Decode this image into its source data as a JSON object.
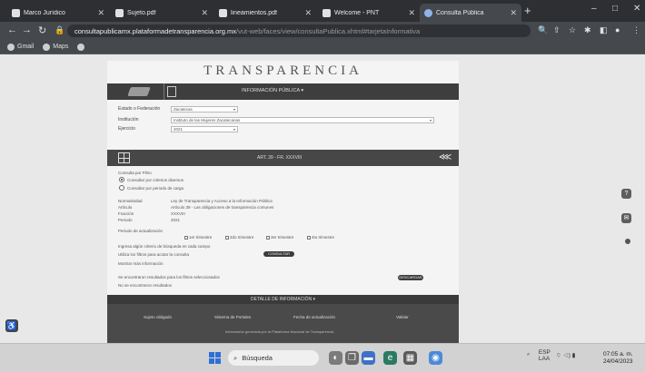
{
  "browser": {
    "tabs": [
      {
        "label": "Marco Jurídico",
        "active": false
      },
      {
        "label": "Sujeto.pdf",
        "active": false
      },
      {
        "label": "lineamientos.pdf",
        "active": false
      },
      {
        "label": "Welcome - PNT",
        "active": false
      },
      {
        "label": "Consulta Pública",
        "active": true
      }
    ],
    "new_tab": "+",
    "window_controls": [
      "–",
      "□",
      "✕"
    ],
    "url_host": "consultapublicamx.plataformadetransparencia.org.mx",
    "url_path": "/vut-web/faces/view/consultaPublica.xhtml#tarjetaInformativa",
    "bookmarks": [
      "Gmail",
      "Maps"
    ]
  },
  "site": {
    "brand": "TRANSPARENCIA",
    "nav_label": "INFORMACIÓN PÚBLICA",
    "form": {
      "state_label": "Estado o Federación",
      "state_value": "Zacatecas",
      "institution_label": "Institución",
      "institution_value": "Instituto de las Mujeres Zacatecanas",
      "period_label": "Ejercicio",
      "period_value": "2021"
    },
    "section_label": "ART. 39 - FR. XXXVIII",
    "filter_title": "Consulta por Filtro",
    "filter_options": [
      "Consultar por criterios diversos",
      "Consultar por periodo de carga"
    ],
    "info_rows": [
      {
        "k": "Normatividad",
        "v": "Ley de Transparencia y Acceso a la Información Pública"
      },
      {
        "k": "Artículo",
        "v": "Artículo 39 - Las obligaciones de transparencia comunes"
      },
      {
        "k": "Fracción",
        "v": "XXXVIII"
      },
      {
        "k": "Periodo",
        "v": "2021"
      }
    ],
    "period_label": "Periodo de actualización",
    "period_checks": [
      "1er trimestre",
      "2do trimestre",
      "3er trimestre",
      "4to trimestre"
    ],
    "search_hint": "Ingresa algún criterio de búsqueda en cada campo",
    "search_hint2": "Utiliza los filtros para acotar la consulta",
    "consult_button": "CONSULTAR",
    "more_info": "Mostrar más información",
    "download_note": "Se encontraron resultados para los filtros seleccionados",
    "download_button": "DESCARGAR",
    "results_note": "No se encontraron resultados",
    "footer_head": "DETALLE DE INFORMACIÓN",
    "footer_cols": [
      "Sujeto obligado",
      "Sistema de Portales",
      "Fecha de actualización",
      "Validar"
    ],
    "footer_note": "Información generada por la Plataforma Nacional de Transparencia"
  },
  "taskbar": {
    "search_placeholder": "Búsqueda",
    "lang": "ESP",
    "region": "LAA",
    "time": "07:05 a. m.",
    "date": "24/04/2023"
  }
}
